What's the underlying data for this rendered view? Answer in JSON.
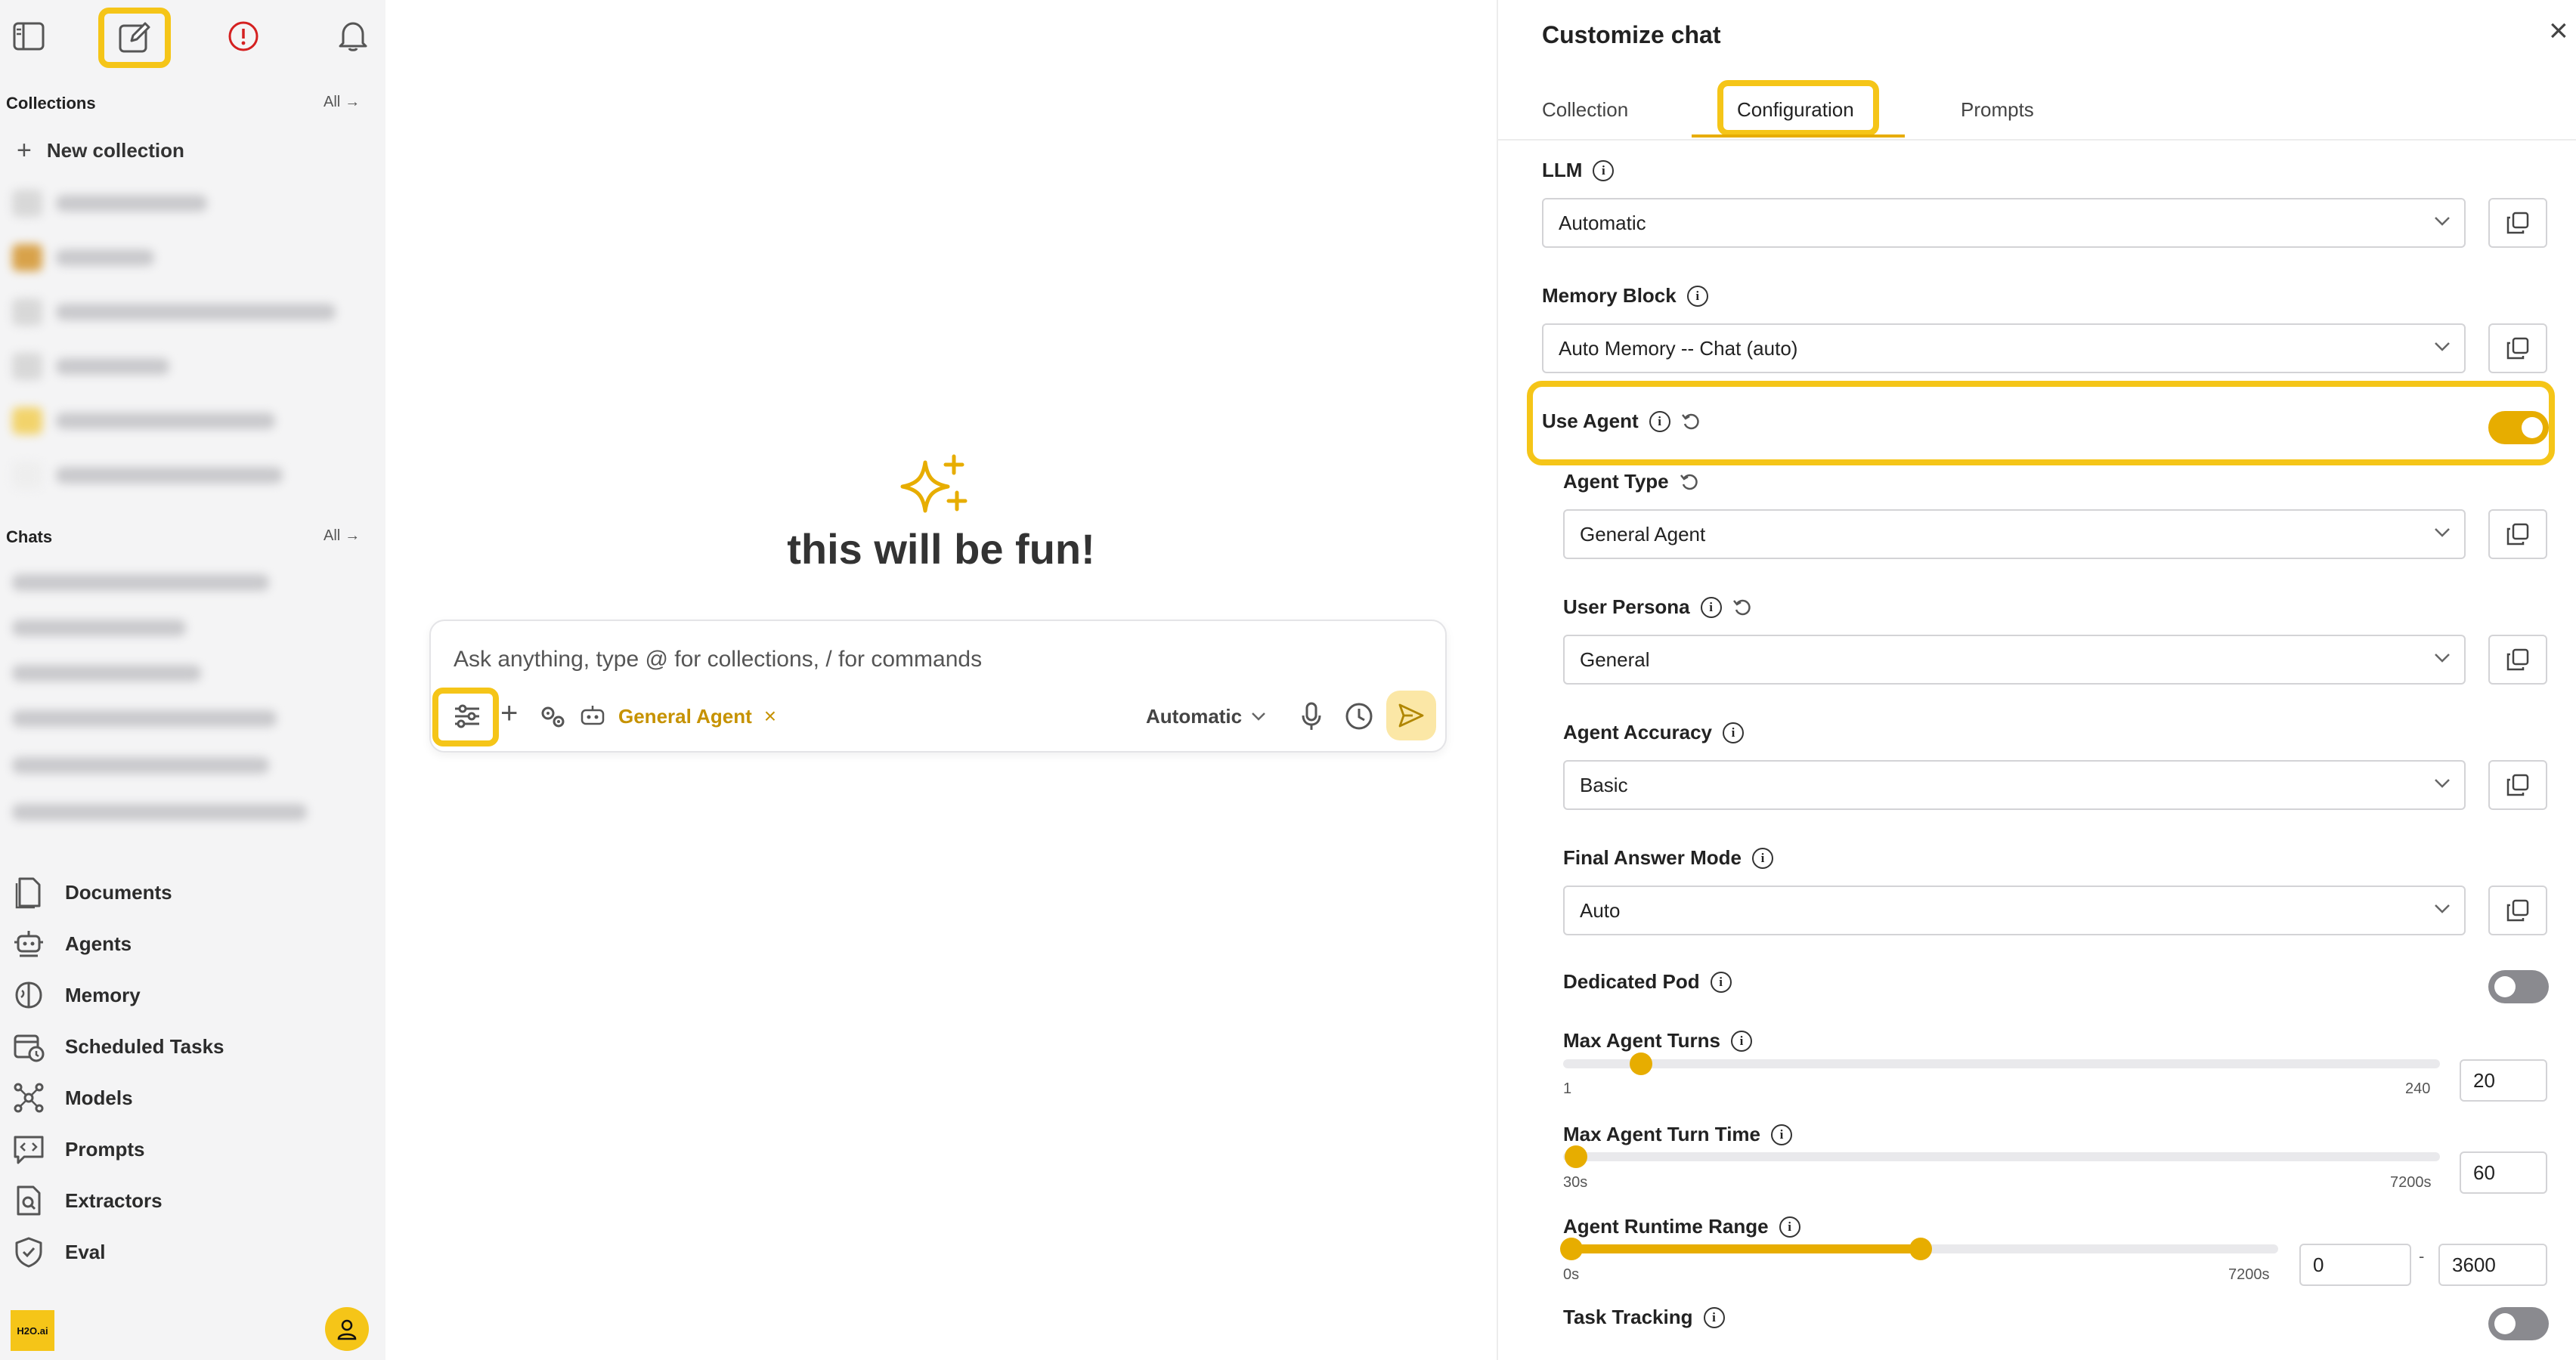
{
  "sidebar": {
    "collections_label": "Collections",
    "collections_all": "All",
    "new_collection": "New collection",
    "chats_label": "Chats",
    "chats_all": "All",
    "nav": [
      {
        "label": "Documents",
        "icon": "document-icon"
      },
      {
        "label": "Agents",
        "icon": "robot-icon"
      },
      {
        "label": "Memory",
        "icon": "brain-icon"
      },
      {
        "label": "Scheduled Tasks",
        "icon": "calendar-clock-icon"
      },
      {
        "label": "Models",
        "icon": "network-icon"
      },
      {
        "label": "Prompts",
        "icon": "code-bubble-icon"
      },
      {
        "label": "Extractors",
        "icon": "file-search-icon"
      },
      {
        "label": "Eval",
        "icon": "shield-check-icon"
      }
    ],
    "logo": "H2O.ai"
  },
  "main": {
    "headline": "this will be fun!",
    "input_placeholder": "Ask anything, type @ for collections, / for commands",
    "agent_chip": "General Agent",
    "model_select": "Automatic"
  },
  "panel": {
    "title": "Customize chat",
    "tabs": [
      "Collection",
      "Configuration",
      "Prompts"
    ],
    "active_tab": "Configuration",
    "llm_label": "LLM",
    "llm_value": "Automatic",
    "memory_label": "Memory Block",
    "memory_value": "Auto Memory -- Chat (auto)",
    "use_agent_label": "Use Agent",
    "use_agent_on": true,
    "agent_type_label": "Agent Type",
    "agent_type_value": "General Agent",
    "persona_label": "User Persona",
    "persona_value": "General",
    "accuracy_label": "Agent Accuracy",
    "accuracy_value": "Basic",
    "final_mode_label": "Final Answer Mode",
    "final_mode_value": "Auto",
    "dedicated_pod_label": "Dedicated Pod",
    "dedicated_pod_on": false,
    "max_turns_label": "Max Agent Turns",
    "max_turns_min": "1",
    "max_turns_max": "240",
    "max_turns_value": "20",
    "max_turn_time_label": "Max Agent Turn Time",
    "max_turn_time_min": "30s",
    "max_turn_time_max": "7200s",
    "max_turn_time_value": "60",
    "runtime_label": "Agent Runtime Range",
    "runtime_min_tick": "0s",
    "runtime_max_tick": "7200s",
    "runtime_low": "0",
    "runtime_sep": "-",
    "runtime_high": "3600",
    "task_tracking_label": "Task Tracking",
    "task_tracking_on": false
  },
  "colors": {
    "accent": "#f5c518",
    "accent_dark": "#e7ad00",
    "alert": "#d42020"
  }
}
